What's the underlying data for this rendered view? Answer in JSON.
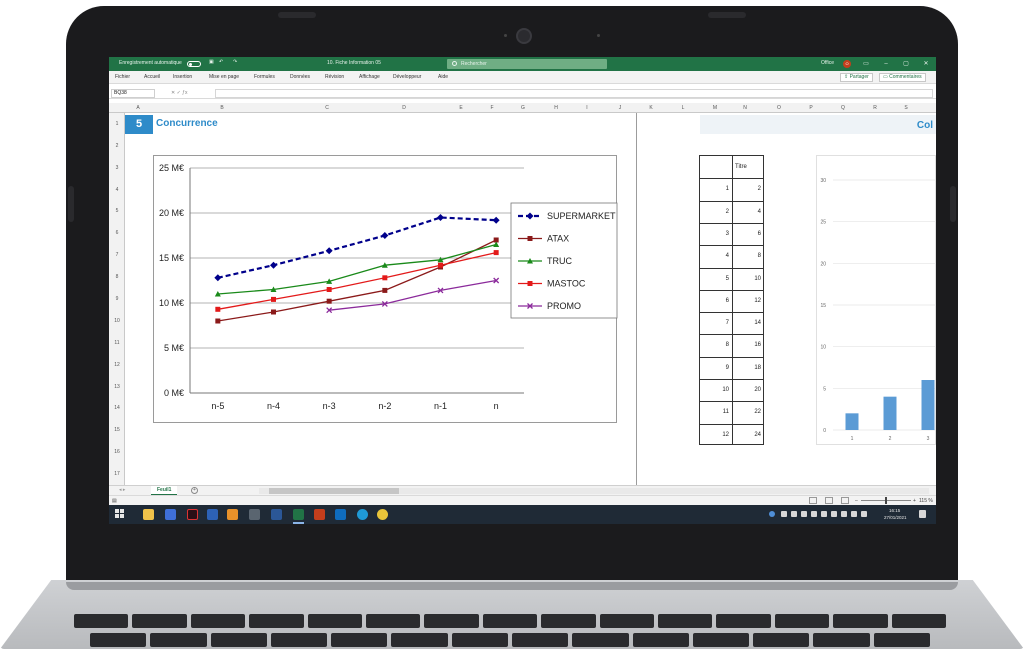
{
  "excel": {
    "autosave_label": "Enregistrement automatique",
    "filename": "10. Fiche Information 05",
    "search_placeholder": "Rechercher",
    "office_label": "Office",
    "user_initial": "O",
    "menu": [
      "Fichier",
      "Accueil",
      "Insertion",
      "Mise en page",
      "Formules",
      "Données",
      "Révision",
      "Affichage",
      "Développeur",
      "Aide"
    ],
    "share_label": "Partager",
    "comments_label": "Commentaires",
    "name_box": "BQ38",
    "columns": [
      "A",
      "B",
      "C",
      "D",
      "E",
      "F",
      "G",
      "H",
      "I",
      "J",
      "K",
      "L",
      "M",
      "N",
      "O",
      "P",
      "Q",
      "R",
      "S"
    ],
    "rows": [
      "1",
      "2",
      "3",
      "4",
      "5",
      "6",
      "7",
      "8",
      "9",
      "10",
      "11",
      "12",
      "13",
      "14",
      "15",
      "16",
      "17"
    ],
    "sheet_tab": "Feuil1",
    "zoom_label": "115 %"
  },
  "section": {
    "number": "5",
    "title": "Concurrence",
    "right_title": "Col"
  },
  "table": {
    "header": "Titre",
    "rows": [
      [
        "1",
        "2"
      ],
      [
        "2",
        "4"
      ],
      [
        "3",
        "6"
      ],
      [
        "4",
        "8"
      ],
      [
        "5",
        "10"
      ],
      [
        "6",
        "12"
      ],
      [
        "7",
        "14"
      ],
      [
        "8",
        "16"
      ],
      [
        "9",
        "18"
      ],
      [
        "10",
        "20"
      ],
      [
        "11",
        "22"
      ],
      [
        "12",
        "24"
      ]
    ]
  },
  "chart_data": [
    {
      "type": "line",
      "categories": [
        "n-5",
        "n-4",
        "n-3",
        "n-2",
        "n-1",
        "n"
      ],
      "ylim": [
        0,
        25
      ],
      "yticks": [
        "0 M€",
        "5 M€",
        "10 M€",
        "15 M€",
        "20 M€",
        "25 M€"
      ],
      "grid": true,
      "legend": "right",
      "series": [
        {
          "name": "SUPERMARKET",
          "values": [
            12.8,
            14.2,
            15.8,
            17.5,
            19.5,
            19.2
          ],
          "color": "#00008b",
          "dashed": true,
          "marker": "diamond"
        },
        {
          "name": "ATAX",
          "values": [
            8.0,
            9.0,
            10.2,
            11.4,
            14.0,
            17.0
          ],
          "color": "#8b1a1a",
          "dashed": false,
          "marker": "square"
        },
        {
          "name": "TRUC",
          "values": [
            11.0,
            11.5,
            12.4,
            14.2,
            14.8,
            16.5
          ],
          "color": "#1a8a1a",
          "dashed": false,
          "marker": "triangle"
        },
        {
          "name": "MASTOC",
          "values": [
            9.3,
            10.4,
            11.5,
            12.8,
            14.2,
            15.6
          ],
          "color": "#e31a1a",
          "dashed": false,
          "marker": "square"
        },
        {
          "name": "PROMO",
          "values": [
            null,
            null,
            9.2,
            9.9,
            11.4,
            12.5
          ],
          "color": "#8b2a9b",
          "dashed": false,
          "marker": "x"
        }
      ]
    },
    {
      "type": "bar",
      "categories": [
        "1",
        "2",
        "3"
      ],
      "values": [
        2,
        4,
        6
      ],
      "ylim": [
        0,
        30
      ],
      "yticks": [
        "0",
        "5",
        "10",
        "15",
        "20",
        "25",
        "30"
      ],
      "color": "#5b9bd5"
    }
  ],
  "taskbar": {
    "time": "16:15",
    "date": "27/01/2021"
  }
}
